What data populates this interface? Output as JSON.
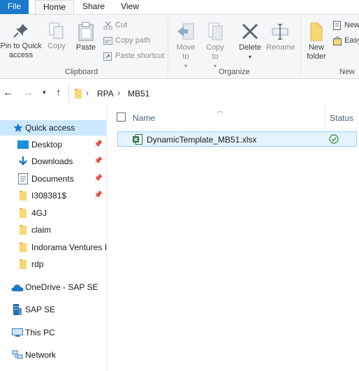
{
  "ribbon": {
    "tabs": {
      "file": "File",
      "home": "Home",
      "share": "Share",
      "view": "View"
    },
    "clipboard": {
      "pin_to_quick_access": "Pin to Quick access",
      "copy": "Copy",
      "paste": "Paste",
      "cut": "Cut",
      "copy_path": "Copy path",
      "paste_shortcut": "Paste shortcut",
      "group_label": "Clipboard"
    },
    "organize": {
      "move_to": "Move to",
      "copy_to": "Copy to",
      "delete": "Delete",
      "rename": "Rename",
      "group_label": "Organize"
    },
    "new": {
      "new_folder": "New folder",
      "new_item": "New",
      "easy_access": "Easy",
      "group_label": "New"
    }
  },
  "address_bar": {
    "breadcrumb": [
      "RPA",
      "MB51"
    ]
  },
  "navigation_pane": {
    "quick_access": "Quick access",
    "items": [
      {
        "label": "Desktop",
        "icon": "desktop-icon",
        "pinned": true
      },
      {
        "label": "Downloads",
        "icon": "download-icon",
        "pinned": true
      },
      {
        "label": "Documents",
        "icon": "documents-icon",
        "pinned": true
      },
      {
        "label": "I308381$",
        "icon": "folder-icon",
        "pinned": true
      },
      {
        "label": "4GJ",
        "icon": "folder-icon",
        "pinned": false
      },
      {
        "label": "claim",
        "icon": "folder-icon",
        "pinned": false
      },
      {
        "label": "Indorama Ventures I",
        "icon": "folder-icon",
        "pinned": false
      },
      {
        "label": "rdp",
        "icon": "folder-icon",
        "pinned": false
      }
    ],
    "onedrive": "OneDrive - SAP SE",
    "sap_se": "SAP SE",
    "this_pc": "This PC",
    "network": "Network"
  },
  "file_list": {
    "columns": {
      "name": "Name",
      "status": "Status"
    },
    "files": [
      {
        "name": "DynamicTemplate_MB51.xlsx",
        "icon": "excel-file-icon",
        "status": "synced-check-icon"
      }
    ]
  },
  "colors": {
    "accent": "#1979ca",
    "selection": "#cce8ff",
    "folder": "#f8d775",
    "excel": "#1d6f42",
    "synced": "#2f8a2f"
  }
}
